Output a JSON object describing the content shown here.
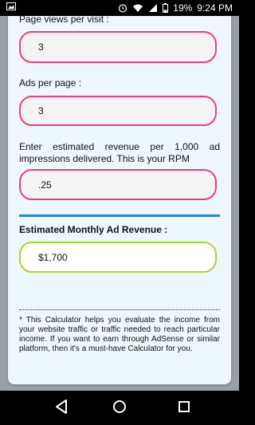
{
  "status_bar": {
    "battery": "19%",
    "time": "9:24 PM"
  },
  "form": {
    "page_views_label": "Page views per visit :",
    "page_views_value": "3",
    "ads_per_page_label": "Ads per page :",
    "ads_per_page_value": "3",
    "rpm_label": "Enter estimated revenue per 1,000 ad impressions delivered. This is your RPM",
    "rpm_value": ".25",
    "result_label": "Estimated Monthly Ad Revenue :",
    "result_value": "$1,700",
    "note": "* This Calculator helps you evaluate the income from your website traffic or traffic needed to reach particular income. If you want to earn through AdSense or similar platform, then it's a must-have Calculator for you."
  },
  "colors": {
    "input_border": "#ee3a86",
    "result_border": "#a6d62d",
    "divider": "#2386d8"
  }
}
